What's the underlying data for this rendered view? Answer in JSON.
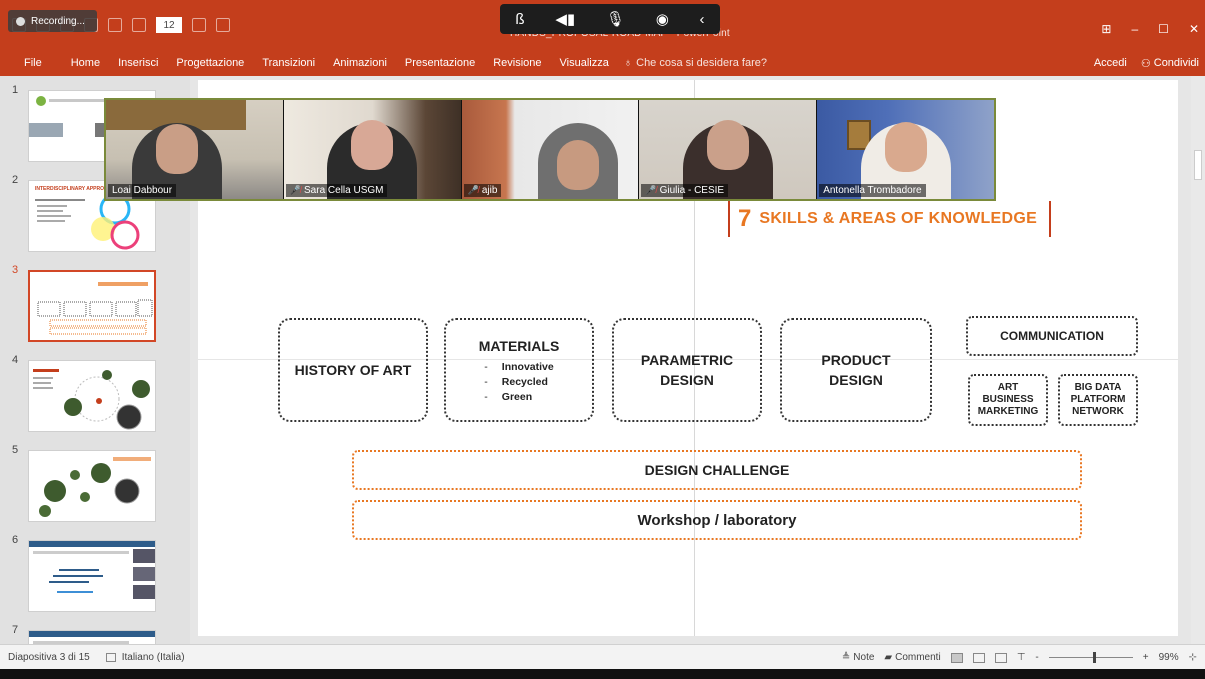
{
  "app": {
    "recording_label": "Recording...",
    "document_title": "HANDS_PROPOSAL-ROAD-MAP - PowerPoint",
    "font_size_value": "12",
    "window_controls": [
      "⊞",
      "–",
      "☐",
      "✕"
    ],
    "accent_color": "#c43e1c"
  },
  "meeting_toolbar": {
    "icons": [
      "effects-icon",
      "speaker-icon",
      "microphone-icon",
      "broadcast-icon",
      "collapse-icon"
    ]
  },
  "ribbon": {
    "tabs": [
      "File",
      "Home",
      "Inserisci",
      "Progettazione",
      "Transizioni",
      "Animazioni",
      "Presentazione",
      "Revisione",
      "Visualizza"
    ],
    "tell_me_placeholder": "Che cosa si desidera fare?",
    "sign_in": "Accedi",
    "share": "Condividi"
  },
  "thumbnails": [
    {
      "number": "1"
    },
    {
      "number": "2",
      "title": "INTERDISCIPLINARY APPROACH"
    },
    {
      "number": "3",
      "active": true
    },
    {
      "number": "4"
    },
    {
      "number": "5"
    },
    {
      "number": "6"
    },
    {
      "number": "7"
    }
  ],
  "participants": [
    {
      "name": "Loai Dabbour",
      "muted": false
    },
    {
      "name": "Sara Cella USGM",
      "muted": true
    },
    {
      "name": "ajib",
      "muted": true
    },
    {
      "name": "Giulia - CESIE",
      "muted": true
    },
    {
      "name": "Antonella Trombadore",
      "muted": false,
      "speaking": true
    }
  ],
  "slide": {
    "title_number": "7",
    "title_text": "SKILLS & AREAS OF KNOWLEDGE",
    "boxes": {
      "history": "HISTORY OF ART",
      "materials_title": "MATERIALS",
      "materials_items": [
        "Innovative",
        "Recycled",
        "Green"
      ],
      "parametric_1": "PARAMETRIC",
      "parametric_2": "DESIGN",
      "product_1": "PRODUCT",
      "product_2": "DESIGN",
      "communication": "COMMUNICATION",
      "art_1": "ART",
      "art_2": "BUSINESS",
      "art_3": "MARKETING",
      "bigdata_1": "BIG DATA",
      "bigdata_2": "PLATFORM",
      "bigdata_3": "NETWORK"
    },
    "design_challenge": "DESIGN CHALLENGE",
    "workshop": "Workshop / laboratory"
  },
  "status": {
    "slide_info": "Diapositiva 3 di 15",
    "language": "Italiano (Italia)",
    "notes": "Note",
    "comments": "Commenti",
    "zoom_minus": "-",
    "zoom_plus": "+",
    "zoom": "99%"
  }
}
